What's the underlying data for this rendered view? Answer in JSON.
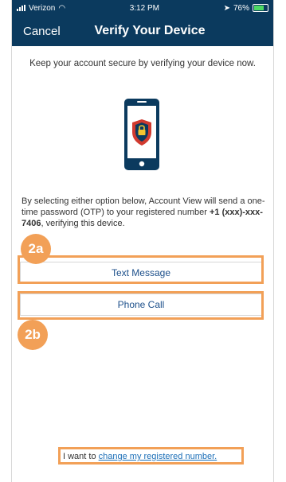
{
  "status_bar": {
    "carrier": "Verizon",
    "time": "3:12 PM",
    "battery": "76%",
    "battery_level": 0.76
  },
  "nav": {
    "cancel_label": "Cancel",
    "title": "Verify Your Device"
  },
  "intro_text": "Keep your account secure by verifying your device now.",
  "description": {
    "prefix": "By selecting either option below, Account View will send a one-time password (OTP) to your registered number ",
    "number": "+1 (xxx)-xxx-7406",
    "suffix": ", verifying this device."
  },
  "buttons": {
    "text_message": "Text Message",
    "phone_call": "Phone Call"
  },
  "badges": {
    "a": "2a",
    "b": "2b"
  },
  "footer": {
    "prefix": "I want to ",
    "link": "change my registered number."
  },
  "colors": {
    "header": "#0b3a5e",
    "highlight": "#f2a057",
    "button_text": "#1c4f8a",
    "link": "#1c6fb8"
  },
  "icons": [
    "signal-icon",
    "wifi-icon",
    "location-icon",
    "battery-icon",
    "phone-shield-lock-icon"
  ]
}
